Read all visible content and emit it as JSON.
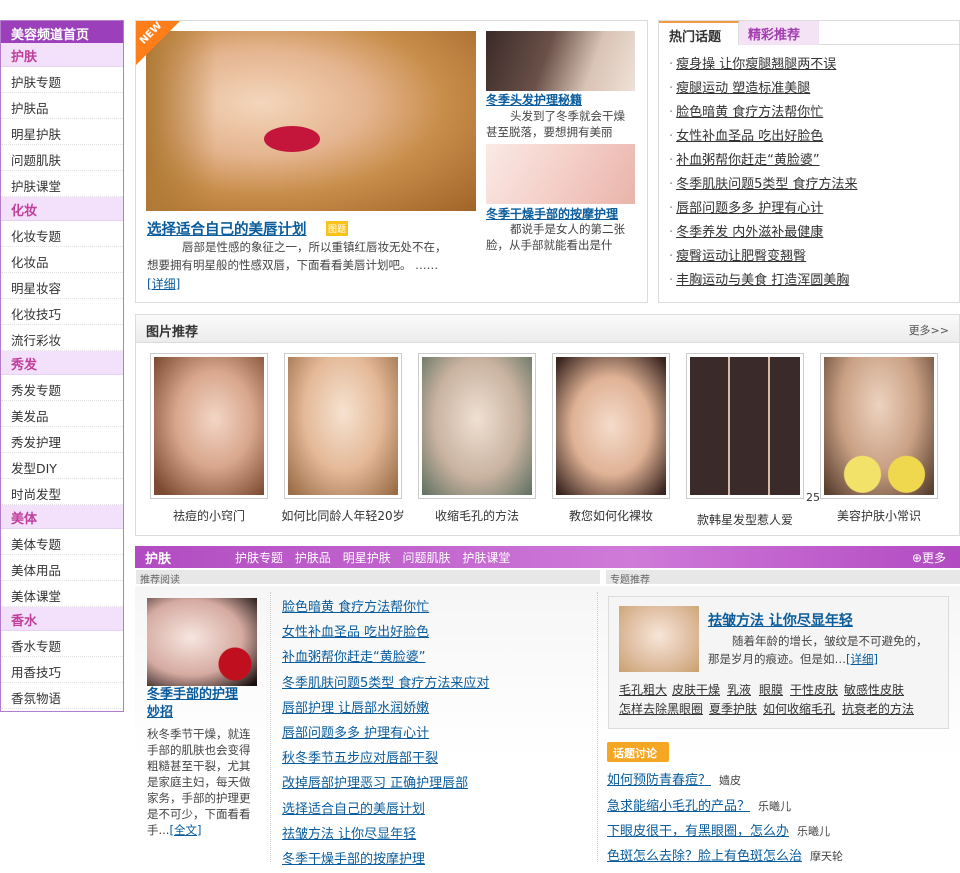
{
  "nav": {
    "header": "美容频道首页",
    "groups": [
      {
        "title": "护肤",
        "items": [
          "护肤专题",
          "护肤品",
          "明星护肤",
          "问题肌肤",
          "护肤课堂"
        ]
      },
      {
        "title": "化妆",
        "items": [
          "化妆专题",
          "化妆品",
          "明星妆容",
          "化妆技巧",
          "流行彩妆"
        ]
      },
      {
        "title": "秀发",
        "items": [
          "秀发专题",
          "美发品",
          "秀发护理",
          "发型DIY",
          "时尚发型"
        ]
      },
      {
        "title": "美体",
        "items": [
          "美体专题",
          "美体用品",
          "美体课堂"
        ]
      },
      {
        "title": "香水",
        "items": [
          "香水专题",
          "用香技巧",
          "香氛物语"
        ]
      }
    ]
  },
  "featured": {
    "badge": "NEW",
    "main_title": "选择适合自己的美唇计划",
    "main_tag": "图题",
    "main_desc_1": "唇部是性感的象征之一，所以重镇红唇妆无处不在，",
    "main_desc_2": "想要拥有明星般的性感双唇，下面看看美唇计划吧。  ……",
    "main_more": "[详细]",
    "side1_title": "冬季头发护理秘籍",
    "side1_desc_1": "头发到了冬季就会干燥",
    "side1_desc_2": "甚至脱落，要想拥有美丽",
    "side2_title": "冬季干燥手部的按摩护理",
    "side2_desc_1": "都说手是女人的第二张",
    "side2_desc_2": "脸，从手部就能看出是什"
  },
  "hot": {
    "tab_active": "热门话题",
    "tab_other": "精彩推荐",
    "bullet": "·",
    "items": [
      "瘦身操 让你瘦腿翘腿两不误",
      "瘦腿运动 塑造标准美腿",
      "脸色暗黄 食疗方法帮你忙",
      "女性补血圣品 吃出好脸色",
      "补血粥帮你赶走“黄脸婆”",
      "冬季肌肤问题5类型 食疗方法来",
      "唇部问题多多 护理有心计",
      "冬季养发 内外滋补最健康",
      "瘦臀运动让肥臀变翘臀",
      "丰胸运动与美食 打造浑圆美胸"
    ]
  },
  "pics": {
    "title": "图片推荐",
    "more": "更多>>",
    "count": "25",
    "captions": [
      "祛痘的小窍门",
      "如何比同龄人年轻20岁",
      "收缩毛孔的方法",
      "教您如何化裸妆",
      "款韩星发型惹人爱",
      "美容护肤小常识"
    ]
  },
  "skin": {
    "title": "护肤",
    "links": [
      "护肤专题",
      "护肤品",
      "明星护肤",
      "问题肌肤",
      "护肤课堂"
    ],
    "more": "更多",
    "sub_left": "推荐阅读",
    "sub_right": "专题推荐",
    "left_article_title_1": "冬季手部的护理",
    "left_article_title_2": "妙招",
    "left_article_desc": [
      "秋冬季节干燥，就连",
      "手部的肌肤也会变得",
      "粗糙甚至干裂，尤其",
      "是家庭主妇，每天做",
      "家务，手部的护理更",
      "是不可少，下面看看"
    ],
    "left_article_tail": "手...",
    "left_article_more": "[全文]",
    "articles": [
      "脸色暗黄 食疗方法帮你忙",
      "女性补血圣品 吃出好脸色",
      "补血粥帮你赶走“黄脸婆”",
      "冬季肌肤问题5类型 食疗方法来应对",
      "唇部护理 让唇部水润娇嫩",
      "唇部问题多多 护理有心计",
      "秋冬季节五步应对唇部干裂",
      "改掉唇部护理恶习 正确护理唇部",
      "选择适合自己的美唇计划",
      "祛皱方法 让你尽显年轻",
      "冬季干燥手部的按摩护理"
    ],
    "topic_title": "祛皱方法 让你尽显年轻",
    "topic_desc_1": "随着年龄的增长，皱纹是不可避免的，",
    "topic_desc_2": "那是岁月的痕迹。但是如…",
    "topic_more": "[详细]",
    "tags_row1": [
      "毛孔粗大",
      "皮肤干燥",
      "乳液",
      "眼膜",
      "干性皮肤",
      "敏感性皮肤"
    ],
    "tags_row2": [
      "怎样去除黑眼圈",
      "夏季护肤",
      "如何收缩毛孔",
      "抗衰老的方法"
    ],
    "discussion_badge": "话题讨论",
    "discussions": [
      {
        "q": "如何预防青春痘？",
        "u": "嫱皮"
      },
      {
        "q": "急求能缩小毛孔的产品？",
        "u": "乐曦儿"
      },
      {
        "q": "下眼皮很干，有黑眼圈，怎么办",
        "u": "乐曦儿"
      },
      {
        "q": "色斑怎么去除？脸上有色斑怎么治",
        "u": "摩天轮"
      }
    ]
  }
}
